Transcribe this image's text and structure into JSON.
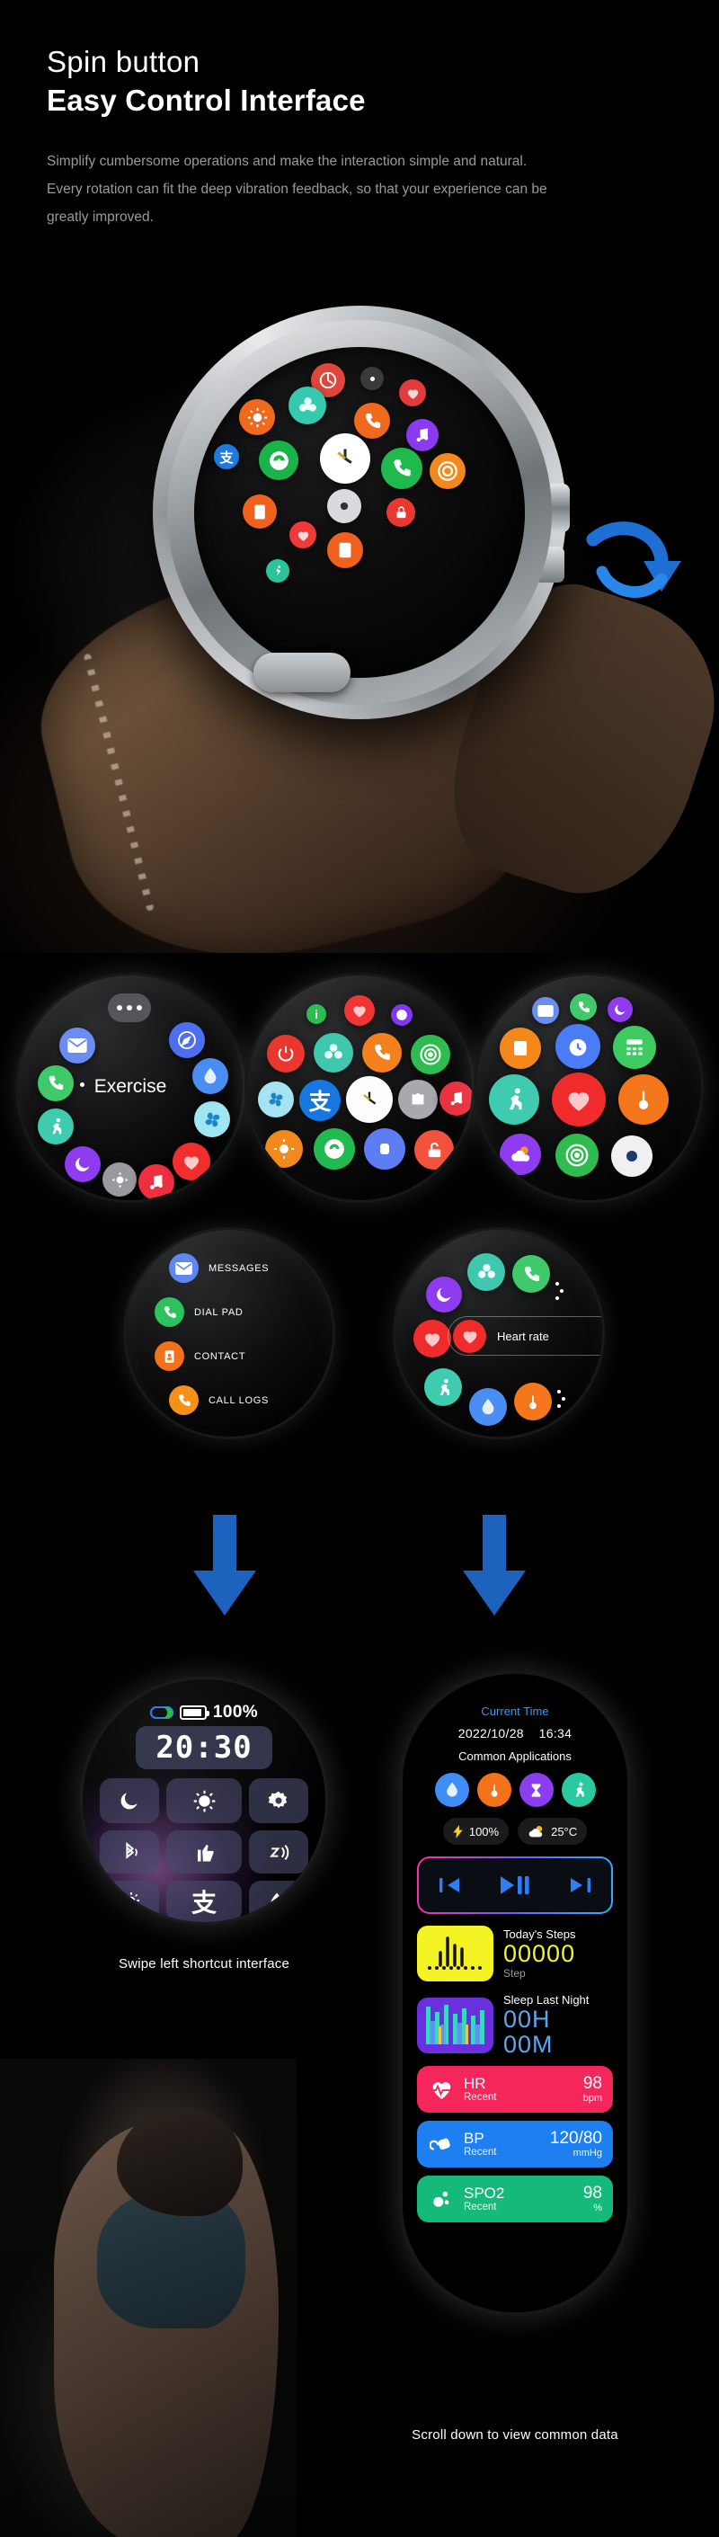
{
  "header": {
    "subtitle": "Spin button",
    "title": "Easy Control Interface",
    "description_line1": "Simplify cumbersome operations and make the interaction simple and natural.",
    "description_line2": "Every rotation can fit the deep vibration feedback, so that your experience can be",
    "description_line3": "greatly improved."
  },
  "hero": {
    "alt": "smartwatch with rotating crown showing app grid",
    "crown_label": "spin-crown"
  },
  "watch_faces": [
    {
      "name": "circular-app-menu-exercise",
      "center_label": "Exercise",
      "icons": [
        "more-icon",
        "messages-icon",
        "phone-icon",
        "running-icon",
        "moon-icon",
        "settings-icon",
        "music-icon",
        "heart-icon",
        "fan-icon",
        "water-drop-icon",
        "compass-icon"
      ]
    },
    {
      "name": "grid-app-menu",
      "center_label": "",
      "icons": [
        "info-icon",
        "heart-icon",
        "globe-icon",
        "power-icon",
        "flower-icon",
        "call-icon",
        "target-icon",
        "fan-icon",
        "alipay-icon",
        "clock-icon",
        "camera-icon",
        "music-icon",
        "brightness-icon",
        "browser-icon",
        "lock-icon",
        "watch-icon"
      ]
    },
    {
      "name": "grid-app-menu-health",
      "center_label": "",
      "icons": [
        "messages-icon",
        "phone-icon",
        "moon-icon",
        "notes-icon",
        "alarm-icon",
        "calculator-icon",
        "running-icon",
        "heart-icon",
        "thermometer-icon",
        "weather-icon",
        "target-icon",
        "camera-icon"
      ]
    }
  ],
  "list_face": {
    "name": "phone-menu-list",
    "items": [
      {
        "label": "MESSAGES",
        "icon": "messages-icon",
        "color": "#5f87f0"
      },
      {
        "label": "DIAL  PAD",
        "icon": "phone-icon",
        "color": "#2ec25f"
      },
      {
        "label": "CONTACT",
        "icon": "contact-icon",
        "color": "#f2721b"
      },
      {
        "label": "CALL  LOGS",
        "icon": "calllog-icon",
        "color": "#f59018"
      }
    ]
  },
  "heart_face": {
    "name": "heart-rate-focus",
    "selected_label": "Heart rate",
    "icons": [
      "moon-icon",
      "flower-icon",
      "phone-icon",
      "heart-icon",
      "running-icon",
      "water-drop-icon",
      "thermometer-icon"
    ]
  },
  "quick_settings": {
    "caption": "Swipe left shortcut interface",
    "battery_percent": "100%",
    "time": "20:30",
    "buttons": [
      {
        "name": "do-not-disturb-button",
        "icon": "moon-icon"
      },
      {
        "name": "brightness-button",
        "icon": "brightness-icon"
      },
      {
        "name": "settings-button",
        "icon": "gear-icon"
      },
      {
        "name": "bluetooth-button",
        "icon": "bluetooth-icon"
      },
      {
        "name": "thumbs-up-button",
        "icon": "thumbs-up-icon"
      },
      {
        "name": "vibration-button",
        "icon": "vibration-icon"
      },
      {
        "name": "flashlight-button",
        "icon": "flashlight-icon"
      },
      {
        "name": "alipay-button",
        "icon": "alipay-icon"
      },
      {
        "name": "water-lock-button",
        "icon": "water-drop-icon"
      }
    ]
  },
  "scroll_panel": {
    "caption": "Scroll down to view common data",
    "current_time_label": "Current Time",
    "date": "2022/10/28",
    "clock": "16:34",
    "common_apps_label": "Common Applications",
    "apps": [
      {
        "name": "water-drop-icon",
        "color": "#3f8ef7"
      },
      {
        "name": "thermometer-icon",
        "color": "#f4731a"
      },
      {
        "name": "hourglass-icon",
        "color": "#8c3df0"
      },
      {
        "name": "running-icon",
        "color": "#2bc9a0"
      }
    ],
    "battery_chip": "100%",
    "weather_chip": "25°C",
    "media": {
      "prev": "previous-track",
      "play": "play-pause",
      "next": "next-track"
    },
    "steps": {
      "label": "Today's Steps",
      "value": "00000",
      "unit": "Step"
    },
    "sleep": {
      "label": "Sleep Last Night",
      "hours": "00H",
      "minutes": "00M"
    },
    "vitals": [
      {
        "name": "HR",
        "sub": "Recent",
        "value": "98",
        "unit": "bpm",
        "color": "#f4265c",
        "icon": "heart-pulse-icon"
      },
      {
        "name": "BP",
        "sub": "Recent",
        "value": "120/80",
        "unit": "mmHg",
        "color": "#1d7ff0",
        "icon": "bp-cuff-icon"
      },
      {
        "name": "SPO2",
        "sub": "Recent",
        "value": "98",
        "unit": "%",
        "color": "#15b979",
        "icon": "spo2-icon"
      }
    ]
  },
  "colors": {
    "background": "#000000",
    "accent_blue": "#2f9bff",
    "arrow_blue": "#1f6fd0",
    "steps_yellow": "#f4f425",
    "sleep_purple": "#6b2fe0",
    "text_muted": "#9a9a9a"
  }
}
